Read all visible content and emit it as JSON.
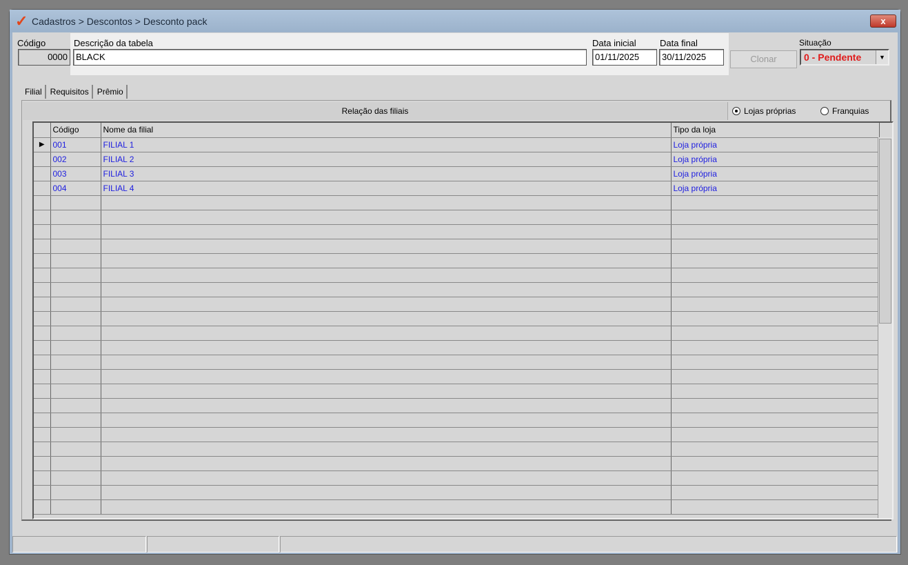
{
  "window": {
    "title": "Cadastros > Descontos > Desconto pack",
    "close_label": "x"
  },
  "form": {
    "codigo_label": "Código",
    "codigo_value": "0000",
    "descricao_label": "Descrição da tabela",
    "descricao_value": "BLACK",
    "data_inicial_label": "Data inicial",
    "data_inicial_value": "01/11/2025",
    "data_final_label": "Data final",
    "data_final_value": "30/11/2025",
    "clonar_label": "Clonar",
    "situacao_label": "Situação",
    "situacao_value": "0 - Pendente"
  },
  "tabs": [
    "Filial",
    "Requisitos",
    "Prêmio"
  ],
  "filiais": {
    "header": "Relação das filiais",
    "radio_proprias": "Lojas próprias",
    "radio_franquias": "Franquias",
    "selected": "Lojas próprias",
    "columns": [
      "Código",
      "Nome da filial",
      "Tipo da loja"
    ],
    "rows": [
      {
        "codigo": "001",
        "nome": "FILIAL 1",
        "tipo": "Loja própria"
      },
      {
        "codigo": "002",
        "nome": "FILIAL 2",
        "tipo": "Loja própria"
      },
      {
        "codigo": "003",
        "nome": "FILIAL 3",
        "tipo": "Loja própria"
      },
      {
        "codigo": "004",
        "nome": "FILIAL 4",
        "tipo": "Loja própria"
      }
    ]
  },
  "colors": {
    "situacao": "#e01b1b",
    "link_text": "#2020e0"
  }
}
